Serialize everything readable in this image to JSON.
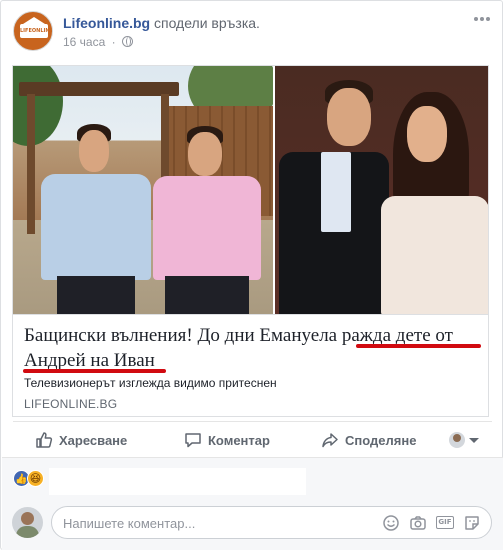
{
  "post": {
    "page_name": "Lifeonline.bg",
    "action_text": "сподели връзка.",
    "timestamp": "16 часа",
    "separator": "·",
    "privacy_icon": "globe-icon",
    "more_icon": "more-horizontal-icon",
    "avatar_logo_text": "LIFEONLINE.BG"
  },
  "attachment": {
    "title_part1": "Бащински вълнения! До дни Емануела ",
    "title_highlight1": "ражда дете от",
    "title_part2": " ",
    "title_highlight2": "Андрей на Иван",
    "description": "Телевизионерът изглежда видимо притеснен",
    "domain": "LIFEONLINE.BG",
    "highlight_color": "#d10a10"
  },
  "actions": {
    "like_label": "Харесване",
    "comment_label": "Коментар",
    "share_label": "Споделяне"
  },
  "reactions": {
    "like_symbol": "👍",
    "haha_symbol": "😆"
  },
  "composer": {
    "placeholder": "Напишете коментар...",
    "icons": [
      "emoji-icon",
      "camera-icon",
      "gif-icon",
      "sticker-icon"
    ]
  },
  "colors": {
    "link_blue": "#365899",
    "muted_gray": "#90949c",
    "like_blue": "#4267b2",
    "haha_yellow": "#f7b125"
  }
}
